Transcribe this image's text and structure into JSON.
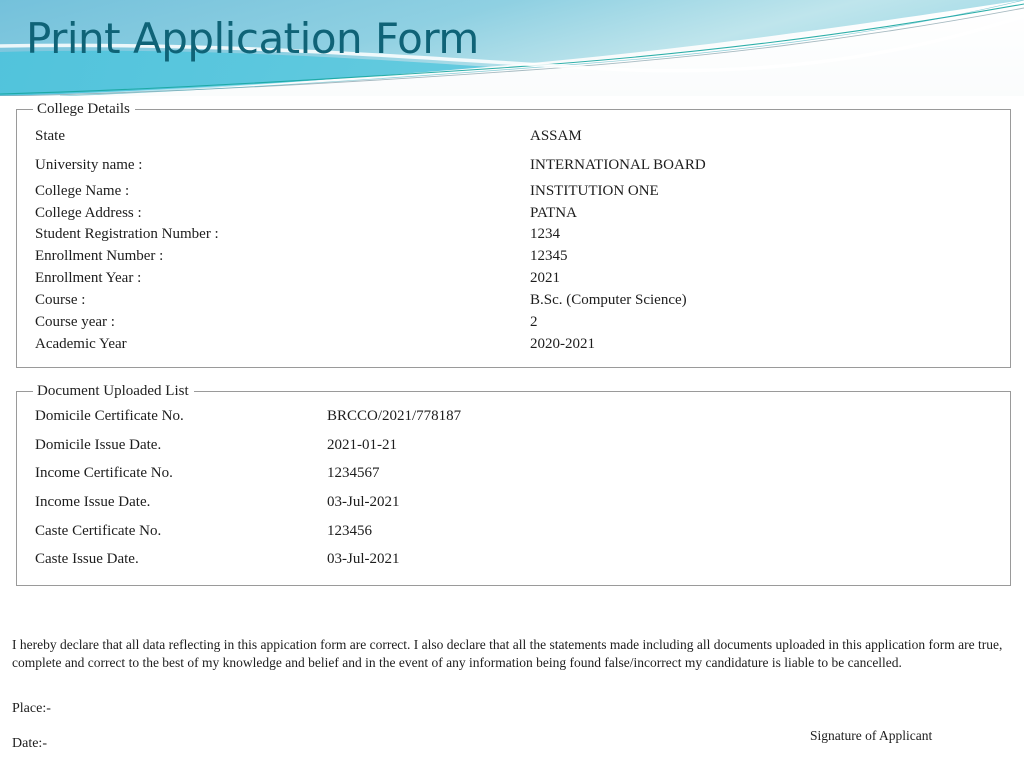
{
  "header": {
    "title": "Print Application Form",
    "title_color": "#0f6377",
    "gradient_top_left": "#7ec5dd",
    "gradient_top_right": "#b9e3ea",
    "band_color": "#58c6dd",
    "accent_line_color": "#14a39a"
  },
  "college_details": {
    "legend": "College Details",
    "rows": [
      {
        "label": "State",
        "value": "ASSAM"
      },
      {
        "label": "University name :",
        "value": "INTERNATIONAL BOARD"
      },
      {
        "label": "College Name :",
        "value": "INSTITUTION ONE"
      },
      {
        "label": "College Address :",
        "value": "PATNA"
      },
      {
        "label": "Student Registration Number :",
        "value": "1234"
      },
      {
        "label": "Enrollment Number :",
        "value": "12345"
      },
      {
        "label": "Enrollment Year :",
        "value": "2021"
      },
      {
        "label": "Course :",
        "value": "B.Sc. (Computer Science)"
      },
      {
        "label": "Course year :",
        "value": "2"
      },
      {
        "label": "Academic Year",
        "value": "2020-2021"
      }
    ]
  },
  "document_uploaded_list": {
    "legend": "Document Uploaded List",
    "rows": [
      {
        "label": "Domicile Certificate No.",
        "value": "BRCCO/2021/778187"
      },
      {
        "label": "Domicile Issue Date.",
        "value": "2021-01-21"
      },
      {
        "label": "Income Certificate No.",
        "value": "1234567"
      },
      {
        "label": "Income Issue Date.",
        "value": "03-Jul-2021"
      },
      {
        "label": "Caste Certificate No.",
        "value": "123456"
      },
      {
        "label": "Caste Issue Date.",
        "value": "03-Jul-2021"
      }
    ]
  },
  "declaration": {
    "text": "I hereby declare that all data reflecting in this appication form are correct. I also declare that all the statements made including all documents uploaded in this application form are true, complete and correct to the best of my knowledge and belief and in the event of any information being found false/incorrect my candidature is liable to be cancelled.",
    "place_label": "Place:-",
    "date_label": "Date:-",
    "signature_label": "Signature of Applicant"
  }
}
